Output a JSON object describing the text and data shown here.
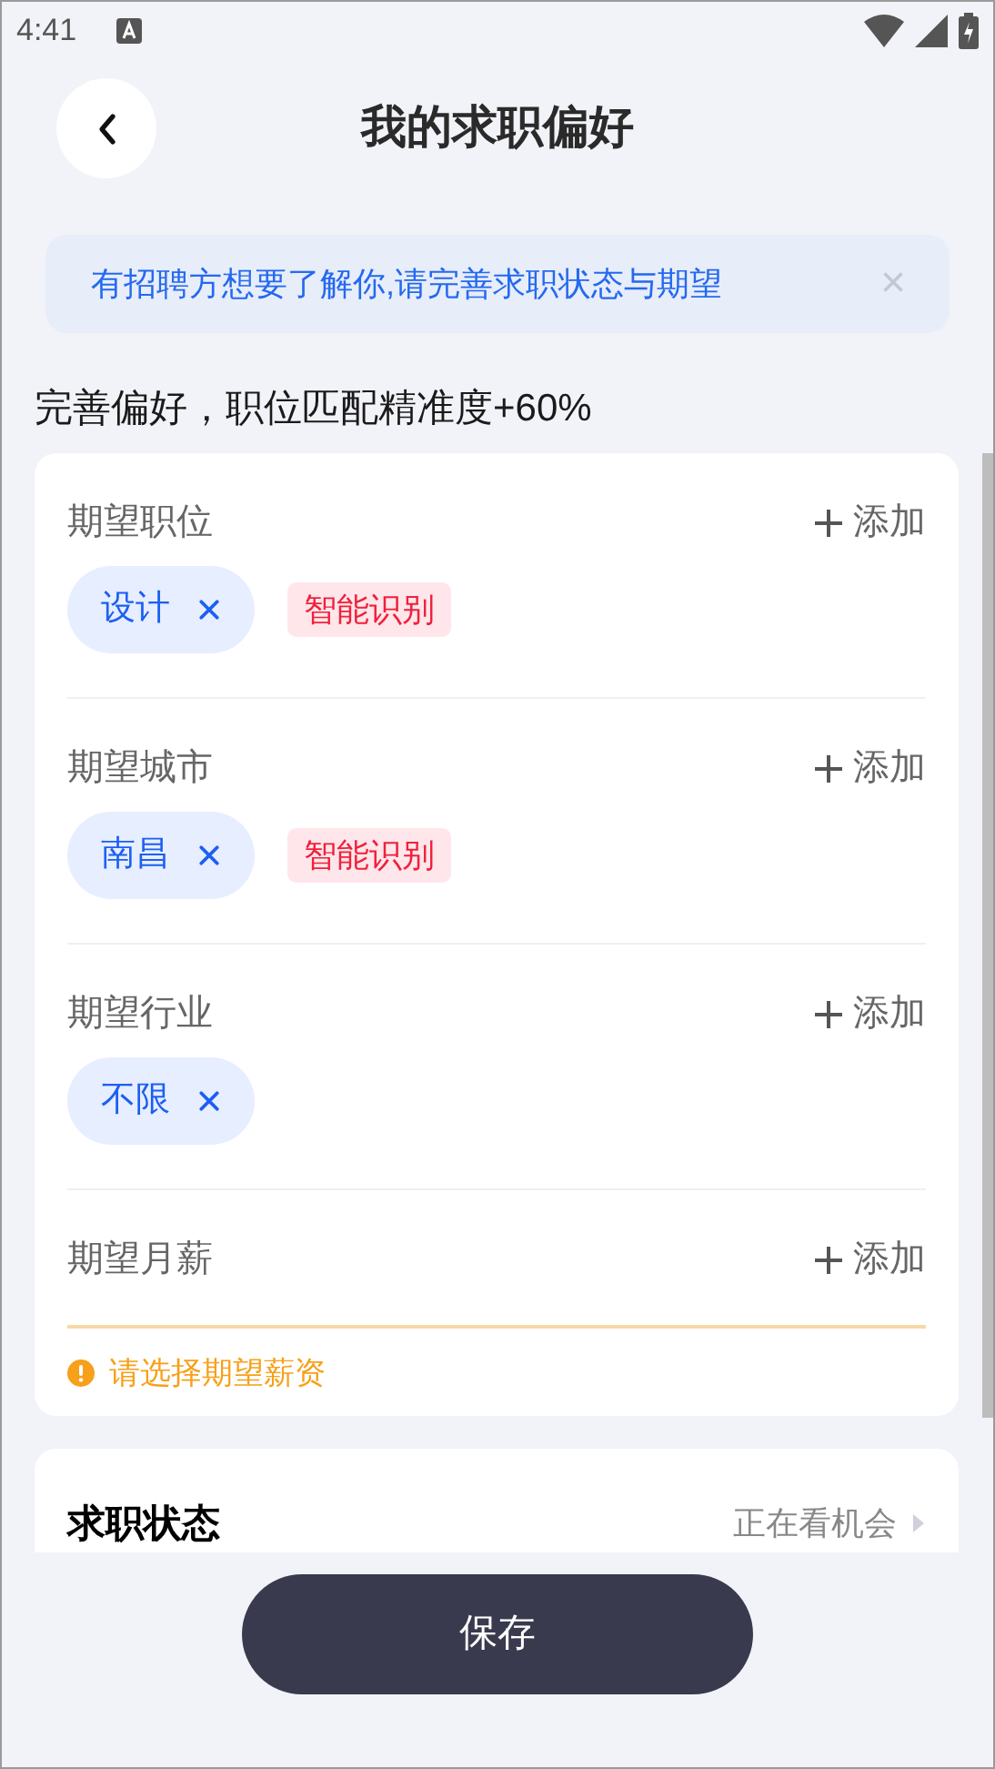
{
  "status_bar": {
    "time": "4:41"
  },
  "header": {
    "title": "我的求职偏好"
  },
  "banner": {
    "text": "有招聘方想要了解你,请完善求职状态与期望",
    "close": "×"
  },
  "subtitle": "完善偏好，职位匹配精准度+60%",
  "sections": [
    {
      "title": "期望职位",
      "add": "添加",
      "tags": [
        "设计"
      ],
      "badge": "智能识别"
    },
    {
      "title": "期望城市",
      "add": "添加",
      "tags": [
        "南昌"
      ],
      "badge": "智能识别"
    },
    {
      "title": "期望行业",
      "add": "添加",
      "tags": [
        "不限"
      ]
    },
    {
      "title": "期望月薪",
      "add": "添加",
      "warning": "请选择期望薪资"
    }
  ],
  "status_row": {
    "title": "求职状态",
    "value": "正在看机会"
  },
  "save_button": "保存"
}
